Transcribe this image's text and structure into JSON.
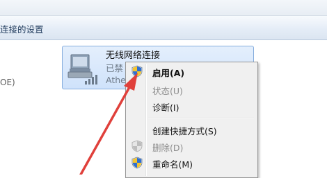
{
  "window": {
    "command_bar_title": "连接的设置"
  },
  "left_fragment": "OE)",
  "network_item": {
    "name": "无线网络连接",
    "status": "已禁",
    "adapter": "Athe"
  },
  "context_menu": {
    "items": [
      {
        "label": "启用(A)",
        "icon": "uac-shield-icon",
        "bold": true,
        "disabled": false
      },
      {
        "label": "状态(U)",
        "icon": "",
        "bold": false,
        "disabled": true
      },
      {
        "label": "诊断(I)",
        "icon": "",
        "bold": false,
        "disabled": false
      },
      {
        "label": "创建快捷方式(S)",
        "icon": "",
        "bold": false,
        "disabled": false
      },
      {
        "label": "删除(D)",
        "icon": "uac-shield-icon",
        "bold": false,
        "disabled": true
      },
      {
        "label": "重命名(M)",
        "icon": "uac-shield-icon",
        "bold": false,
        "disabled": false
      }
    ]
  },
  "colors": {
    "arrow": "#e0403b",
    "selection_border": "#84acdd"
  }
}
